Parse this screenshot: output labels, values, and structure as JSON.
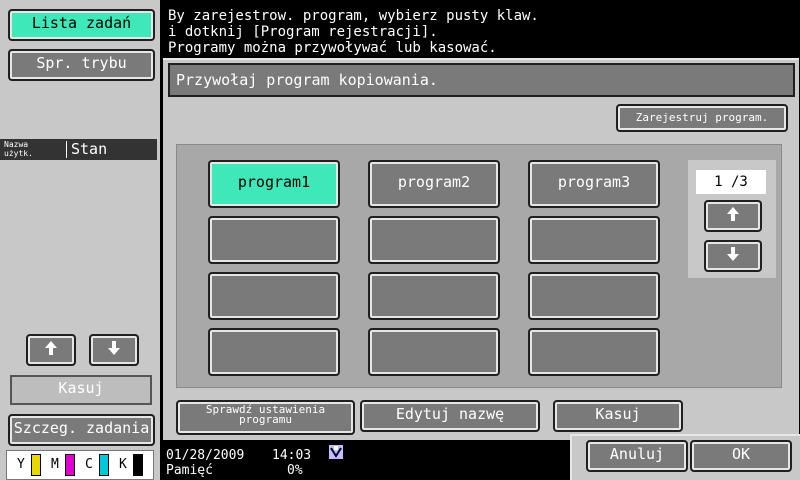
{
  "sidebar": {
    "job_list_label": "Lista zadań",
    "mode_check_label": "Spr. trybu",
    "table_header": {
      "user_name": "Nazwa użytk.",
      "status": "Stan"
    },
    "delete_label": "Kasuj",
    "job_details_label": "Szczeg. zadania",
    "toner": [
      "Y",
      "M",
      "C",
      "K"
    ],
    "toner_colors": [
      "#e8d800",
      "#e000d0",
      "#00c8d8",
      "#000000"
    ]
  },
  "message": {
    "line1": "By zarejestrow. program, wybierz pusty klaw.",
    "line2": "i dotknij [Program rejestracji].",
    "line3": "Programy można przywoływać lub kasować."
  },
  "panel": {
    "title": "Przywołaj program kopiowania.",
    "register_label": "Zarejestruj program.",
    "programs": [
      "program1",
      "program2",
      "program3",
      "",
      "",
      "",
      "",
      "",
      "",
      "",
      "",
      ""
    ],
    "selected_index": 0,
    "page_indicator": "1 /3",
    "check_settings_label": "Sprawdź ustawienia programu",
    "edit_name_label": "Edytuj nazwę",
    "delete_label": "Kasuj",
    "cancel_label": "Anuluj",
    "ok_label": "OK"
  },
  "status": {
    "date": "01/28/2009",
    "time": "14:03",
    "memory_label": "Pamięć",
    "memory_value": "0%"
  },
  "colors": {
    "accent": "#3ee8b8",
    "button_gray": "#7a7a7a",
    "panel": "#c8c8c8"
  }
}
